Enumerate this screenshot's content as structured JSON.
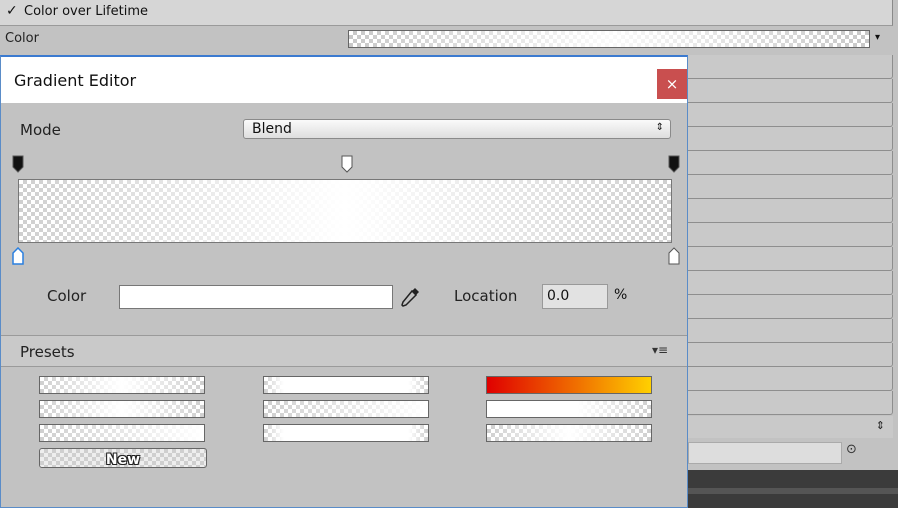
{
  "inspector": {
    "section_check": "✓",
    "section_title": "Color over Lifetime",
    "color_label": "Color",
    "dropdown_arrow": "▾",
    "spin_glyph": "⇕",
    "target_glyph": "⊙"
  },
  "editor": {
    "title": "Gradient Editor",
    "close_glyph": "×",
    "close_color": "#c94f4f",
    "mode": {
      "label": "Mode",
      "value": "Blend",
      "spin_glyph": "⇕"
    },
    "color_label": "Color",
    "location": {
      "label": "Location",
      "value": "0.0",
      "unit": "%"
    },
    "presets": {
      "label": "Presets",
      "menu_glyph": "▾≡",
      "new_label": "New",
      "fire_colors": [
        "#e00000",
        "#f07000",
        "#ffd000"
      ]
    },
    "icons": {
      "close": "close-icon",
      "eyedropper": "eyedropper-icon",
      "menu": "menu-icon"
    }
  }
}
